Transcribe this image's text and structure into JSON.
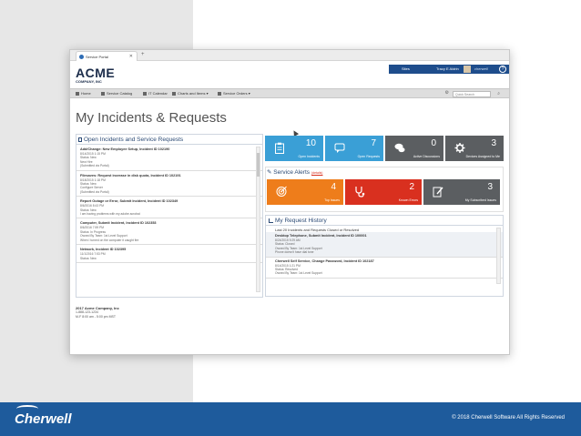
{
  "browser": {
    "tab_title": "Service Portal",
    "tab_close": "✕",
    "new_tab": "+"
  },
  "header": {
    "logo_main": "ACME",
    "logo_sub": "COMPANY, INC",
    "sites_label": "Sites",
    "user_name": "Tracy E Aldrin",
    "brand": "cherwell",
    "help": "?"
  },
  "nav": {
    "items": [
      "Home",
      "Service Catalog",
      "IT Calendar",
      "Charts and Items ▾",
      "Service Orders ▾"
    ],
    "search_placeholder": "Quick Search"
  },
  "page": {
    "title": "My Incidents & Requests"
  },
  "open_panel": {
    "title": "Open Incidents and Service Requests",
    "items": [
      {
        "title": "Add/Change: New Employee Setup, Incident ID 102190",
        "lines": [
          "8/14/2015 1:15 PM",
          "Status: New",
          "New Hire",
          "(Submitted via Portal)"
        ]
      },
      {
        "title": "Filesaves: Request increase in disk quota, Incident ID 102191",
        "lines": [
          "8/18/2015 1:18 PM",
          "Status: New",
          "Configure Server",
          "(Submitted via Portal)"
        ]
      },
      {
        "title": "Report Outage or Error, Submit Incident, Incident ID 102349",
        "lines": [
          "8/6/2016 8:43 PM",
          "Status: New",
          "I am having problems with my adobe acrobat"
        ]
      },
      {
        "title": "Computer, Submit Incident, Incident ID 102353",
        "lines": [
          "8/6/2016 7:59 PM",
          "Status: In Progress",
          "Owned By Team: 1st Level Support",
          "When I turned on the computer it caught fire"
        ]
      },
      {
        "title": "Network, Incident ID 102395",
        "lines": [
          "11/1/2016 7:53 PM",
          "Status: New"
        ]
      }
    ]
  },
  "company": {
    "name": "2017 Acme Company, Inc",
    "phone": "1-888-123-1234",
    "hours": "M-F 8:00 am - 5:00 pm MST"
  },
  "tiles_top": [
    {
      "value": "10",
      "label": "Open Incidents",
      "icon": "clipboard-icon",
      "color": "#3a9fd6"
    },
    {
      "value": "7",
      "label": "Open Requests",
      "icon": "chat-icon",
      "color": "#3a9fd6"
    },
    {
      "value": "0",
      "label": "Active Discussions",
      "icon": "discussion-icon",
      "color": "#5b5e61"
    },
    {
      "value": "3",
      "label": "Devices Assigned to Me",
      "icon": "gear-icon",
      "color": "#5b5e61"
    }
  ],
  "alerts": {
    "title": "Service Alerts",
    "details_link": "(details)",
    "tiles": [
      {
        "value": "4",
        "label": "Top Issues",
        "icon": "target-icon",
        "color": "#ee7d1b"
      },
      {
        "value": "2",
        "label": "Known Errors",
        "icon": "stethoscope-icon",
        "color": "#d9301f"
      },
      {
        "value": "3",
        "label": "My Subscribed Issues",
        "icon": "edit-icon",
        "color": "#5b5e61"
      }
    ]
  },
  "history": {
    "title": "My Request History",
    "subtitle": "Last 20 Incidents and Requests Closed or Resolved",
    "items": [
      {
        "title": "Desktop Telephone, Submit Incident, Incident ID 100001",
        "lines": [
          "8/24/2015 9:29 AM",
          "Status: Closed",
          "Owned By Team: 1st Level Support",
          "Phone doesn't have dial tone"
        ]
      },
      {
        "title": "Cherwell Self Service, Change Password, Incident ID 102187",
        "lines": [
          "8/14/2015 1:21 PM",
          "Status: Resolved",
          "Owned By Team: 1st Level Support"
        ]
      }
    ]
  },
  "footer": {
    "logo": "Cherwell",
    "copyright": "© 2018 Cherwell Software All Rights Reserved"
  }
}
